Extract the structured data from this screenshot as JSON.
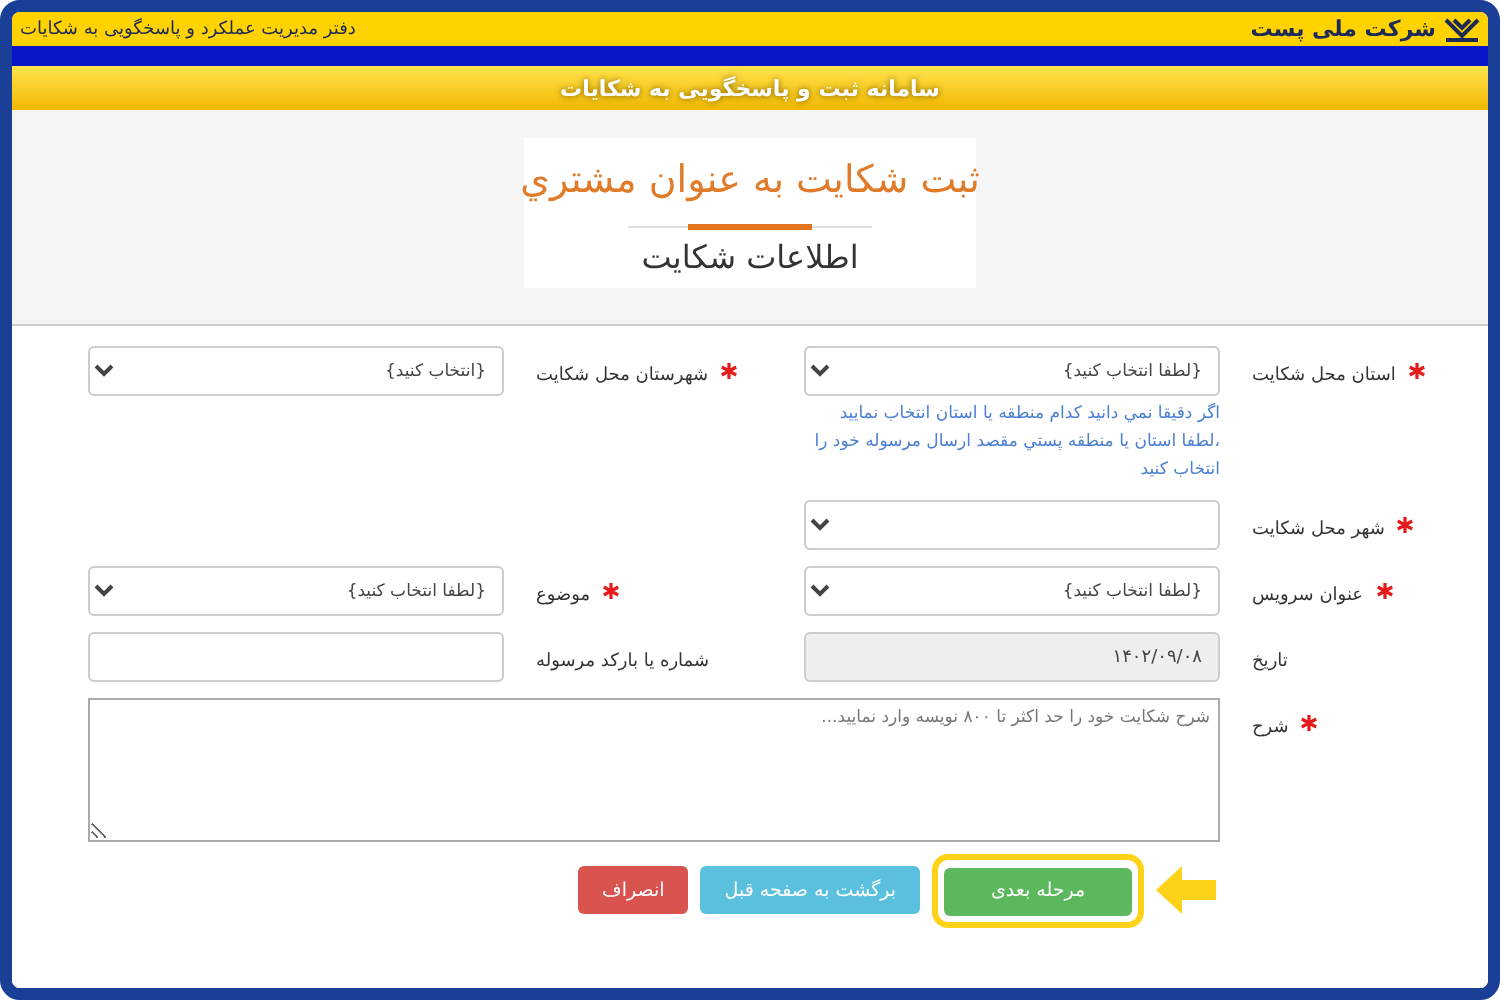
{
  "header": {
    "company": "شرکت ملی پست",
    "office": "دفتر مدیریت عملکرد و پاسخگویی به شکایات",
    "system_title": "سامانه ثبت و پاسخگویی به شکایات"
  },
  "page": {
    "title": "ثبت شکايت به عنوان مشتري",
    "section": "اطلاعات شکايت"
  },
  "rows": [
    {
      "fields": [
        {
          "label": "استان محل شکایت",
          "required": true,
          "kind": "select",
          "value": "{لطفا انتخاب کنید}",
          "hint": "اگر دقيقا نمي دانيد کدام منطقه يا استان انتخاب نماييد ،لطفا استان يا منطقه پستي مقصد ارسال مرسوله خود را انتخاب کنيد"
        },
        {
          "label": "شهرستان محل شکایت",
          "required": true,
          "kind": "select",
          "value": "{انتخاب کنید}"
        }
      ]
    },
    {
      "fields": [
        {
          "label": "شهر محل شکایت",
          "required": true,
          "kind": "select"
        }
      ]
    },
    {
      "fields": [
        {
          "label": "عنوان سرویس",
          "required": true,
          "kind": "select",
          "value": "{لطفا انتخاب کنید}"
        },
        {
          "label": "موضوع",
          "required": true,
          "kind": "select",
          "value": "{لطفا انتخاب کنید}"
        }
      ]
    },
    {
      "fields": [
        {
          "label": "تاریخ",
          "required": false,
          "kind": "text",
          "value": "۱۴۰۲/۰۹/۰۸",
          "disabled": true
        },
        {
          "label": "شماره یا بارکد مرسوله",
          "required": false,
          "kind": "text",
          "disabled": false
        }
      ]
    },
    {
      "fields": [
        {
          "label": "شرح",
          "required": true,
          "kind": "textarea",
          "placeholder": "شرح شکایت خود را حد اکثر تا ۸۰۰ نویسه وارد نمایید..."
        }
      ]
    }
  ],
  "buttons": [
    {
      "label": "مرحله بعدی",
      "kind": "success",
      "highlighted": true
    },
    {
      "label": "برگشت به صفحه قبل",
      "kind": "info",
      "highlighted": false
    },
    {
      "label": "انصراف",
      "kind": "danger",
      "highlighted": false
    }
  ]
}
